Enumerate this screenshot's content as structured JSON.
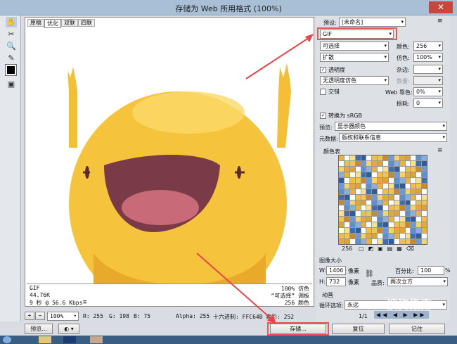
{
  "window": {
    "title": "存储为 Web 所用格式 (100%)",
    "close": "✕"
  },
  "tabs": [
    "原稿",
    "优化",
    "双联",
    "四联"
  ],
  "selected_tab": "优化",
  "info": {
    "format": "GIF",
    "size": "44.76K",
    "time": "9 秒 @ 56.6 Kbps",
    "dither": "100% 仿色",
    "palette": "“可选择” 调板",
    "colors": "256 颜色"
  },
  "status": {
    "zoom": "100%",
    "r": "R: 255",
    "g": "G: 198",
    "b": "B: 75",
    "alpha": "Alpha: 255",
    "hex": "十六进制: FFC64B",
    "index": "索引: 252"
  },
  "right": {
    "preset_label": "预设:",
    "preset_value": "[未命名]",
    "format": "GIF",
    "reduction": "可选择",
    "colors_label": "颜色:",
    "colors_value": "256",
    "dither_algo": "扩散",
    "dither_label": "仿色:",
    "dither_value": "100%",
    "transparency": "透明度",
    "matte_label": "杂边:",
    "trans_dither": "无透明度仿色",
    "amount_label": "数量:",
    "interlaced": "交错",
    "web_snap_label": "Web 靠色:",
    "web_snap_value": "0%",
    "lossy_label": "损耗:",
    "lossy_value": "0",
    "convert_srgb": "转换为 sRGB",
    "preview_label": "预览:",
    "preview_value": "显示器颜色",
    "metadata_label": "元数据:",
    "metadata_value": "版权和联系信息",
    "color_table_label": "颜色表",
    "color_count": "256",
    "image_size_label": "图像大小",
    "w_label": "W:",
    "w_value": "1406",
    "h_label": "H:",
    "h_value": "732",
    "unit": "像素",
    "percent_label": "百分比:",
    "percent_value": "100",
    "percent_unit": "%",
    "quality_label": "品质:",
    "quality_value": "两次立方",
    "animation_label": "动画",
    "loop_label": "循环选项:",
    "loop_value": "永远",
    "frame": "1/1"
  },
  "buttons": {
    "preview": "预览...",
    "save": "存储...",
    "reset": "复位",
    "remember": "记住"
  },
  "watermark": "搜狗指南",
  "palette": [
    "#e8b23c",
    "#f2c64a",
    "#5a8fd0",
    "#ffffff",
    "#d9a53a",
    "#3d6fb3",
    "#f5d36a",
    "#ffffff",
    "#c98a2e",
    "#8aaee0",
    "#f0bd45",
    "#ffffff",
    "#2f5c9e",
    "#e8a838",
    "#fbe08a",
    "#6b9ad8"
  ]
}
